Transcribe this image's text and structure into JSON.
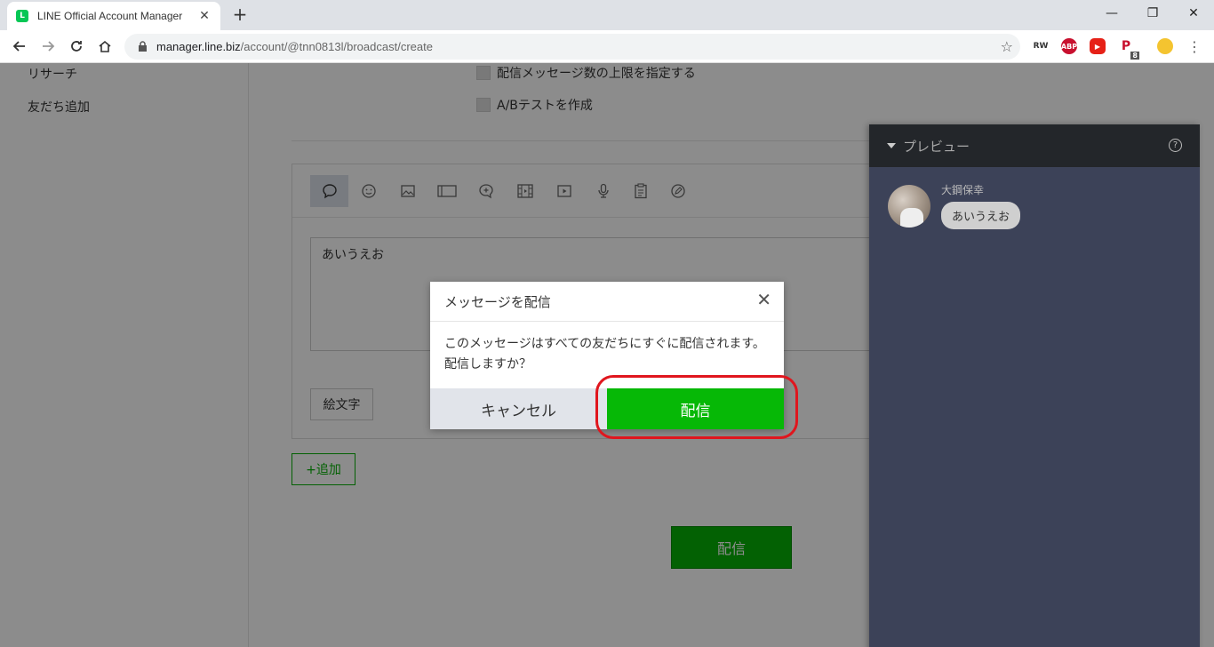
{
  "browser": {
    "tab_title": "LINE Official Account Manager",
    "favicon_letter": "L",
    "url_host": "manager.line.biz",
    "url_path": "/account/@tnn0813l/broadcast/create",
    "extensions": [
      {
        "name": "rw-extension-icon",
        "label": "RW",
        "color": "#555555"
      },
      {
        "name": "adblock-icon",
        "label": "ABP",
        "color": "#c8102e"
      },
      {
        "name": "youtube-extension-icon",
        "label": "▶",
        "color": "#e62117"
      },
      {
        "name": "p-extension-icon",
        "label": "P",
        "color": "#c8102e",
        "badge": "8"
      },
      {
        "name": "profile-avatar-icon",
        "label": "",
        "color": "#f4c430"
      }
    ]
  },
  "sidebar": {
    "items": [
      "リサーチ",
      "友だち追加"
    ]
  },
  "main": {
    "options": [
      "配信メッセージ数の上限を指定する",
      "A/Bテストを作成"
    ],
    "message_text": "あいうえお",
    "emoji_label": "絵文字",
    "add_label": "+追加",
    "send_label": "配信"
  },
  "preview": {
    "title": "プレビュー",
    "help": "?",
    "sender_name": "大鋼保幸",
    "bubble_text": "あいうえお"
  },
  "modal": {
    "title": "メッセージを配信",
    "body": "このメッセージはすべての友だちにすぐに配信されます。配信しますか？",
    "cancel_label": "キャンセル",
    "confirm_label": "配信"
  },
  "colors": {
    "line_green": "#06b806",
    "highlight_red": "#e0161e",
    "preview_bg": "#3c4258"
  }
}
